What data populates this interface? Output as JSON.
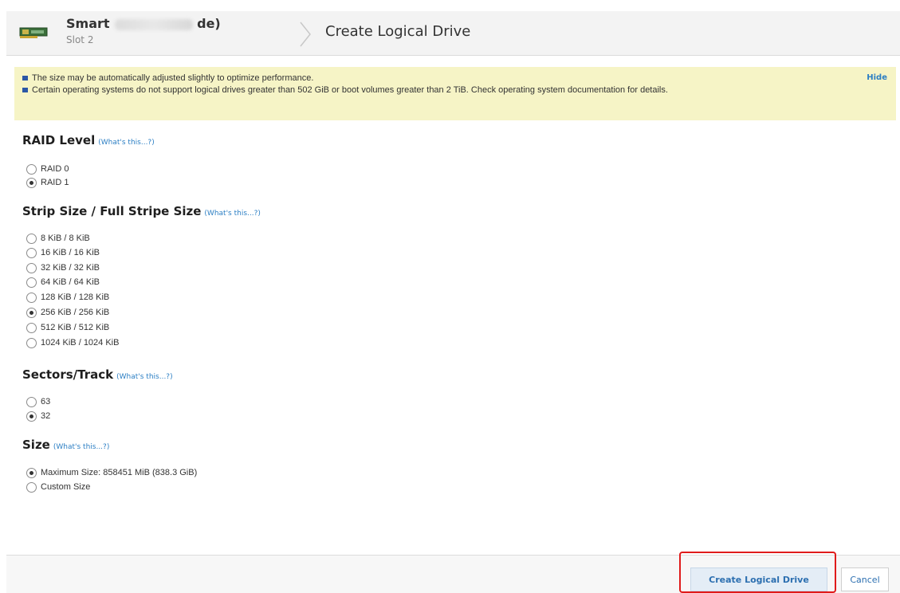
{
  "header": {
    "controller_name": "Smart",
    "controller_name_tail": "de)",
    "slot": "Slot 2",
    "page_title": "Create Logical Drive"
  },
  "info": {
    "messages": [
      "The size may be automatically adjusted slightly to optimize performance.",
      "Certain operating systems do not support logical drives greater than 502 GiB or boot volumes greater than 2 TiB. Check operating system documentation for details."
    ],
    "hide_label": "Hide"
  },
  "help_link_label": "(What's this...?)",
  "raid": {
    "title": "RAID Level",
    "options": [
      "RAID 0",
      "RAID 1"
    ],
    "selected": "RAID 1"
  },
  "strip": {
    "title": "Strip Size / Full Stripe Size",
    "options": [
      "8 KiB / 8 KiB",
      "16 KiB / 16 KiB",
      "32 KiB / 32 KiB",
      "64 KiB / 64 KiB",
      "128 KiB / 128 KiB",
      "256 KiB / 256 KiB",
      "512 KiB / 512 KiB",
      "1024 KiB / 1024 KiB"
    ],
    "selected": "256 KiB / 256 KiB"
  },
  "sectors": {
    "title": "Sectors/Track",
    "options": [
      "63",
      "32"
    ],
    "selected": "32"
  },
  "size": {
    "title": "Size",
    "options": [
      "Maximum Size: 858451 MiB (838.3 GiB)",
      "Custom Size"
    ],
    "selected": "Maximum Size: 858451 MiB (838.3 GiB)"
  },
  "footer": {
    "create_label": "Create Logical Drive",
    "cancel_label": "Cancel"
  },
  "colors": {
    "accent": "#2c7fc4",
    "info_background": "#f6f4c6",
    "highlight": "#e01b1b"
  }
}
